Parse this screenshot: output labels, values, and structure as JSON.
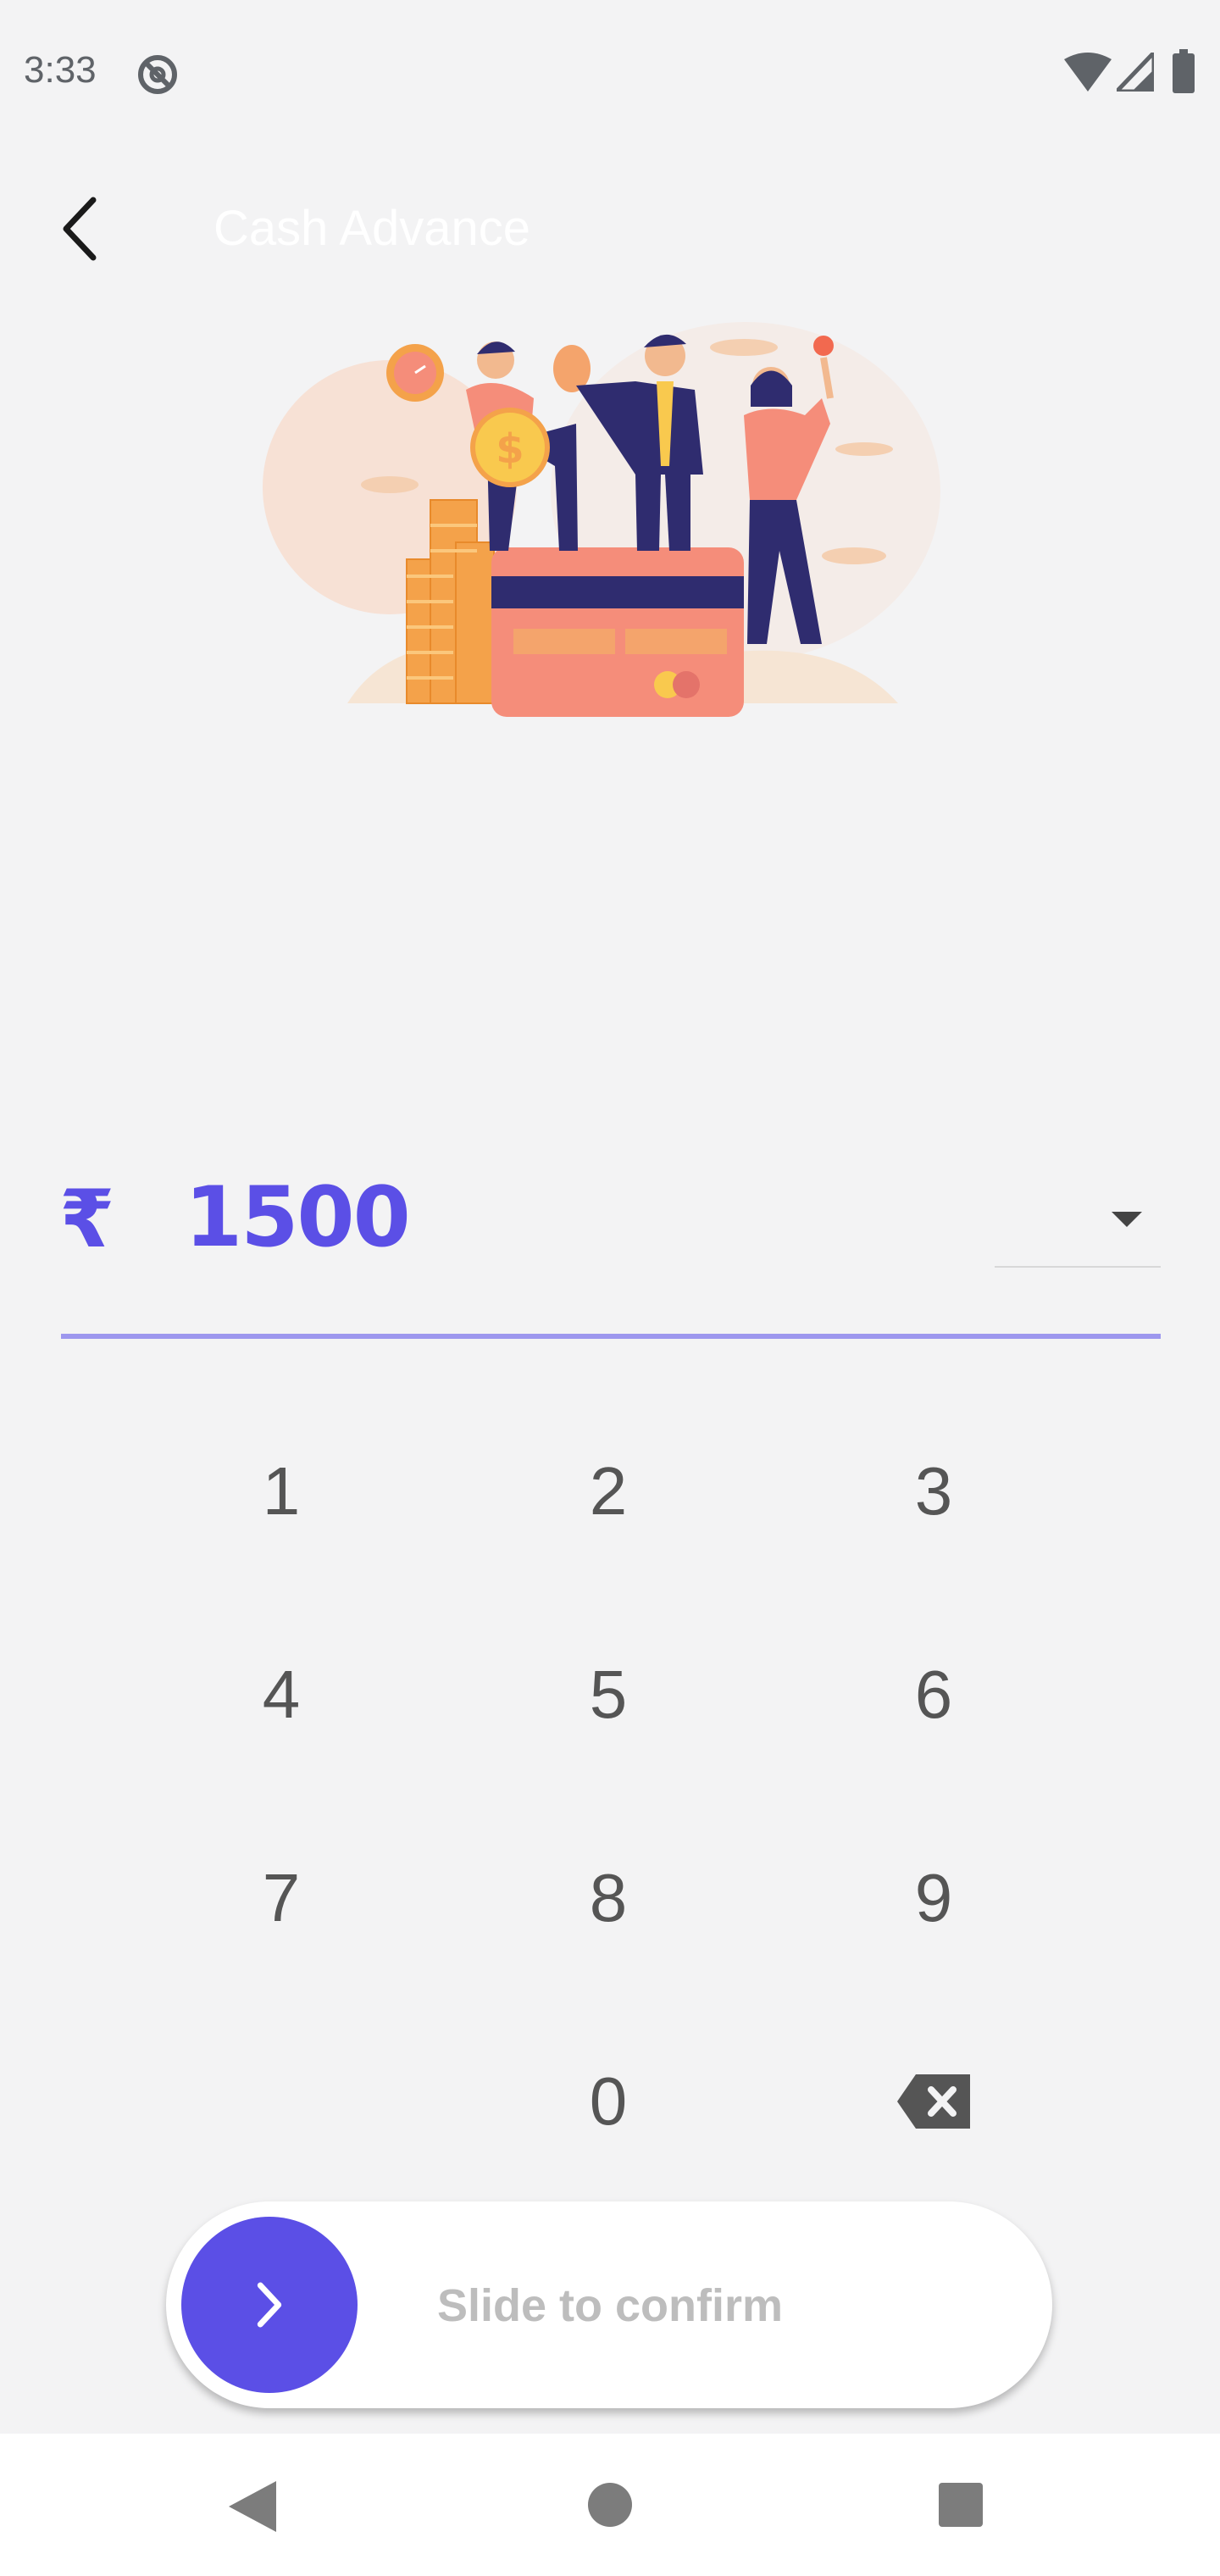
{
  "status_bar": {
    "time": "3:33",
    "icons": [
      "do-not-disturb-icon",
      "wifi-icon",
      "signal-icon",
      "battery-icon"
    ]
  },
  "header": {
    "back_icon": "chevron-left-icon",
    "title": "Cash Advance"
  },
  "illustration": {
    "icon": "people-with-money-and-card-illustration"
  },
  "amount": {
    "currency_symbol": "₹",
    "value": "1500",
    "dropdown_icon": "caret-down-icon"
  },
  "keypad": {
    "keys": [
      "1",
      "2",
      "3",
      "4",
      "5",
      "6",
      "7",
      "8",
      "9",
      "0"
    ],
    "backspace_icon": "backspace-icon"
  },
  "slider": {
    "label": "Slide to confirm",
    "knob_icon": "chevron-right-icon"
  },
  "nav_bar": {
    "icons": [
      "nav-back-icon",
      "nav-home-icon",
      "nav-recents-icon"
    ]
  },
  "colors": {
    "accent": "#5b4fe6",
    "background": "#f3f3f4",
    "underline": "#9d97ee",
    "keypad_text": "#555555",
    "slider_label": "#bdbdbd"
  }
}
